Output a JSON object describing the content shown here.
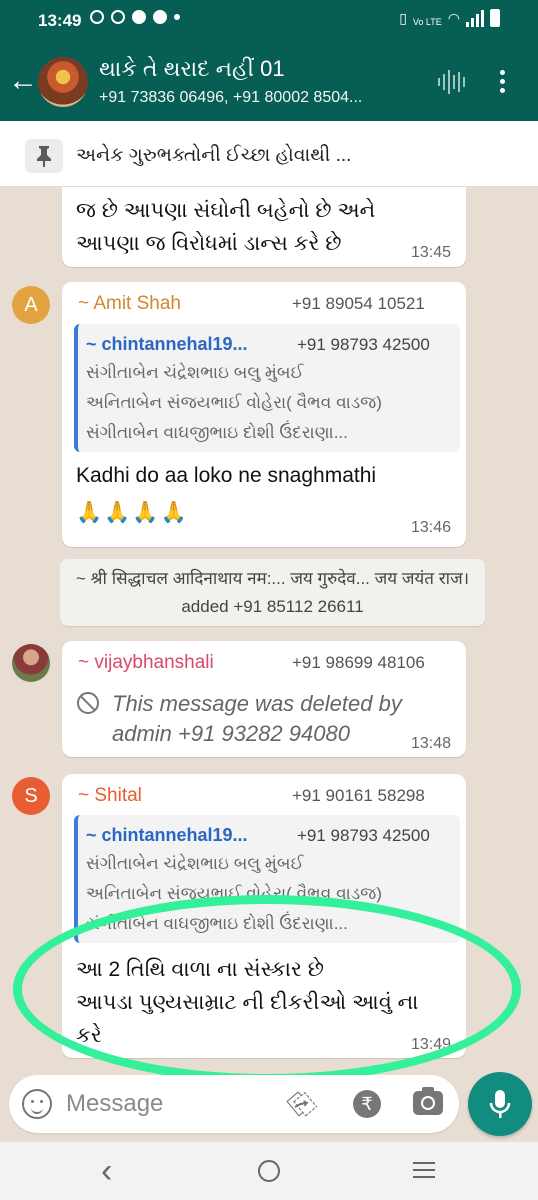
{
  "status_bar": {
    "time": "13:49",
    "network_label": "Vo LTE"
  },
  "header": {
    "title": "થાકે તે થરાદ નહીં 01",
    "members": "+91 73836 06496, +91 80002 8504..."
  },
  "pinned": {
    "text": "અનેક ગુરુભક્તોની ઈચ્છા હોવાથી ..."
  },
  "messages": [
    {
      "lines": [
        "જ છે આપણા સંઘોની બહેનો છે અને",
        "આપણા જ વિરોધમાં ડાન્સ કરે છે"
      ],
      "time": "13:45"
    },
    {
      "avatar_letter": "A",
      "sender": "~ Amit Shah",
      "phone": "+91 89054 10521",
      "quote": {
        "sender": "~ chintannehal19...",
        "phone": "+91 98793 42500",
        "lines": [
          "સંગીતાબેન ચંદ્રેશભાઇ બલુ મુંબઈ",
          "અનિતાબેન સંજયભાઈ વોહેરા( વૈભવ વાડજ)",
          "સંગીતાબેન વાઘજીભાઇ દોશી ઉંદરાણા..."
        ]
      },
      "lines": [
        "Kadhi do aa loko ne snaghmathi",
        "🙏🙏🙏🙏"
      ],
      "time": "13:46"
    },
    {
      "system": "~ श्री सिद्धाचल आदिनाथाय नम:... जय गुरुदेव... जय जयंत राज। added +91 85112 26611"
    },
    {
      "sender": "~ vijaybhanshali",
      "phone": "+91 98699 48106",
      "lines": [
        "This message was deleted by",
        "admin +91 93282 94080"
      ],
      "time": "13:48"
    },
    {
      "avatar_letter": "S",
      "sender": "~ Shital",
      "phone": "+91 90161 58298",
      "quote": {
        "sender": "~ chintannehal19...",
        "phone": "+91 98793 42500",
        "lines": [
          "સંગીતાબેન ચંદ્રેશભાઇ બલુ મુંબઈ",
          "અનિતાબેન સંજયભાઈ વોહેરા( વૈભવ વાડજ)",
          "સંગીતાબેન વાઘજીભાઇ દોશી ઉંદરાણા..."
        ]
      },
      "lines": [
        "આ 2 તિથિ વાળા ના સંસ્કાર છે",
        "આપડા પુણ્યસામ્રાટ ની દીકરીઓ આવું ના",
        "કરે"
      ],
      "time": "13:49"
    }
  ],
  "input": {
    "placeholder": "Message",
    "rupee_symbol": "₹"
  },
  "colors": {
    "header": "#075e54",
    "accent": "#128c7e",
    "amit_name": "#d4862d",
    "vijay_name": "#d9486e",
    "shital_name": "#e85d33",
    "highlight": "#35f09b"
  }
}
